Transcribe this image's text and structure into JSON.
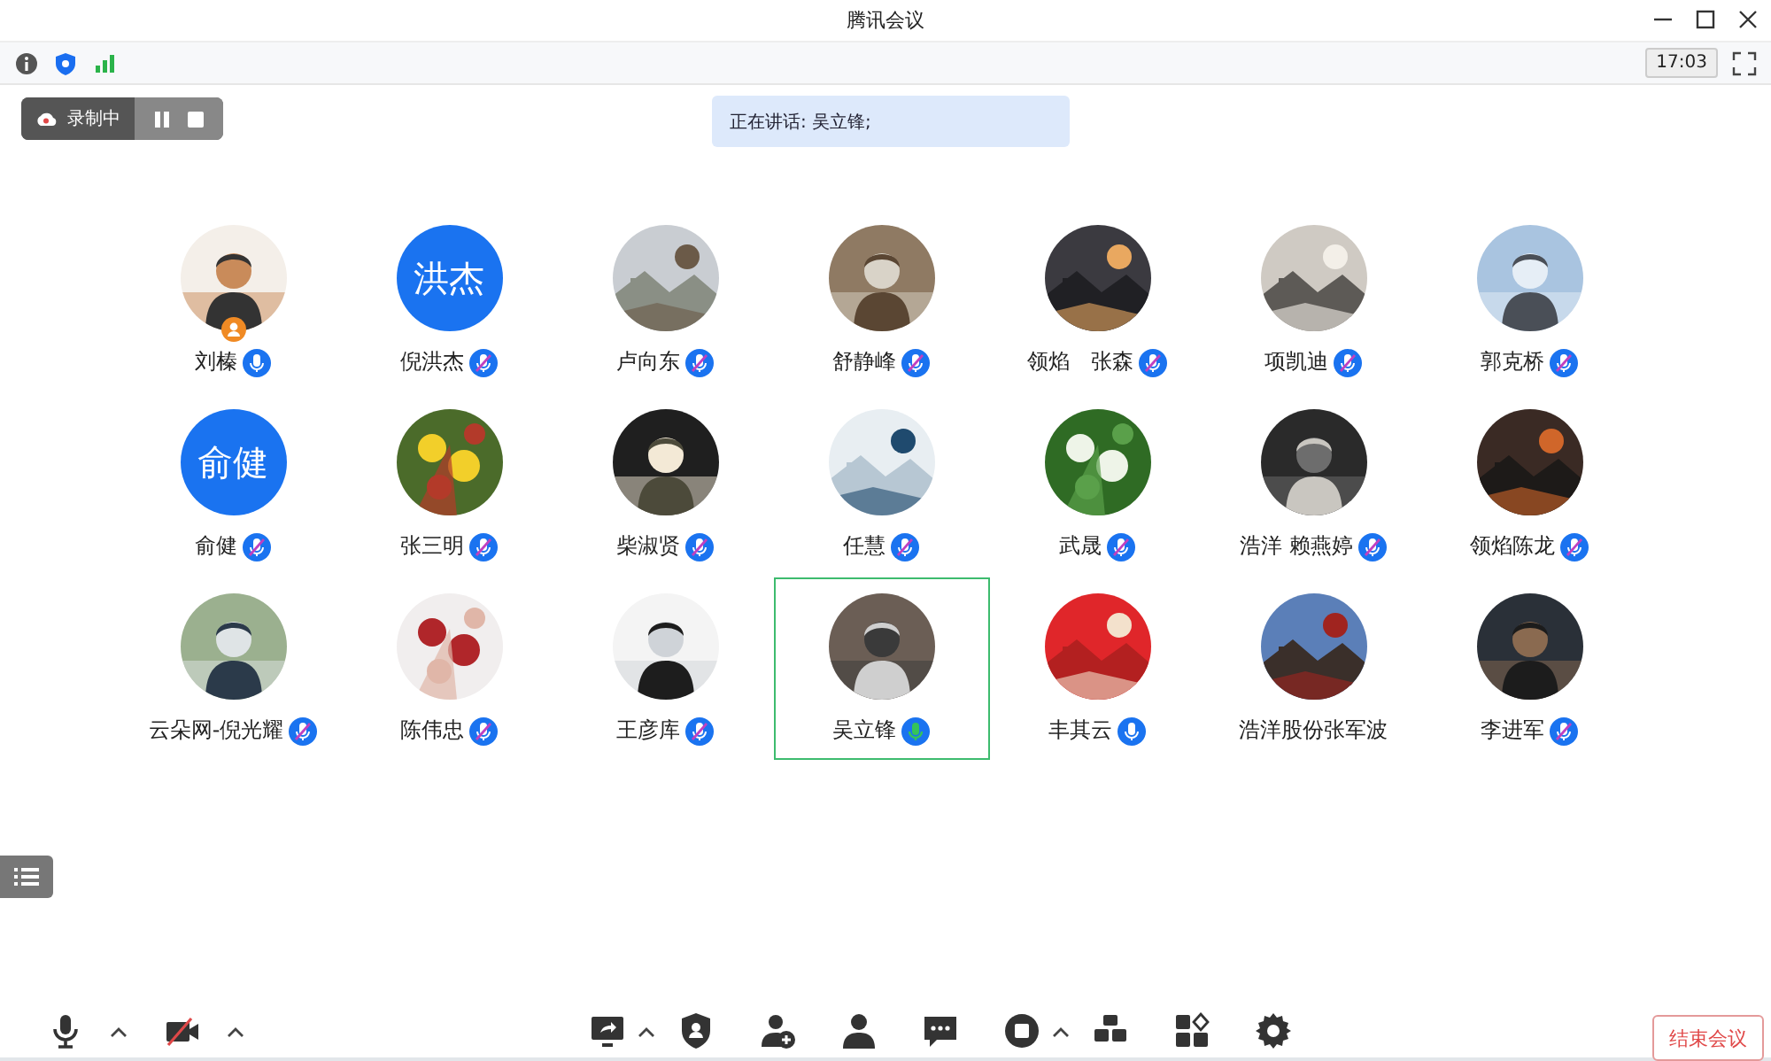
{
  "window": {
    "title": "腾讯会议"
  },
  "status_bar": {
    "time": "17:03"
  },
  "recording": {
    "label": "录制中",
    "paused": false
  },
  "speaking_banner": {
    "text": "正在讲话: 吴立锋;"
  },
  "participants": [
    {
      "name": "刘榛",
      "host": true,
      "mic": {
        "muted": false,
        "speaking": false
      },
      "selected": false
    },
    {
      "name": "倪洪杰",
      "avatar": {
        "kind": "text",
        "text": "洪杰"
      },
      "host": false,
      "mic": {
        "muted": true,
        "speaking": false
      },
      "selected": false
    },
    {
      "name": "卢向东",
      "host": false,
      "mic": {
        "muted": true,
        "speaking": false
      },
      "selected": false
    },
    {
      "name": "舒静峰",
      "host": false,
      "mic": {
        "muted": true,
        "speaking": false
      },
      "selected": false
    },
    {
      "name": "领焰　张森",
      "host": false,
      "mic": {
        "muted": true,
        "speaking": false
      },
      "selected": false
    },
    {
      "name": "项凯迪",
      "host": false,
      "mic": {
        "muted": true,
        "speaking": false
      },
      "selected": false
    },
    {
      "name": "郭克桥",
      "host": false,
      "mic": {
        "muted": true,
        "speaking": false
      },
      "selected": false
    },
    {
      "name": "俞健",
      "avatar": {
        "kind": "text",
        "text": "俞健"
      },
      "host": false,
      "mic": {
        "muted": true,
        "speaking": false
      },
      "selected": false
    },
    {
      "name": "张三明",
      "host": false,
      "mic": {
        "muted": true,
        "speaking": false
      },
      "selected": false
    },
    {
      "name": "柴淑贤",
      "host": false,
      "mic": {
        "muted": true,
        "speaking": false
      },
      "selected": false
    },
    {
      "name": "任慧",
      "host": false,
      "mic": {
        "muted": true,
        "speaking": false
      },
      "selected": false
    },
    {
      "name": "武晟",
      "host": false,
      "mic": {
        "muted": true,
        "speaking": false
      },
      "selected": false
    },
    {
      "name": "浩洋 赖燕婷",
      "host": false,
      "mic": {
        "muted": true,
        "speaking": false
      },
      "selected": false
    },
    {
      "name": "领焰陈龙",
      "host": false,
      "mic": {
        "muted": true,
        "speaking": false
      },
      "selected": false
    },
    {
      "name": "云朵网-倪光耀",
      "host": false,
      "mic": {
        "muted": true,
        "speaking": false
      },
      "selected": false
    },
    {
      "name": "陈伟忠",
      "host": false,
      "mic": {
        "muted": true,
        "speaking": false
      },
      "selected": false
    },
    {
      "name": "王彦库",
      "host": false,
      "mic": {
        "muted": true,
        "speaking": false
      },
      "selected": false
    },
    {
      "name": "吴立锋",
      "host": false,
      "mic": {
        "muted": false,
        "speaking": true
      },
      "selected": true
    },
    {
      "name": "丰其云",
      "host": false,
      "mic": {
        "muted": false,
        "speaking": false
      },
      "selected": false
    },
    {
      "name": "浩洋股份张军波",
      "host": false,
      "selected": false
    },
    {
      "name": "李进军",
      "host": false,
      "mic": {
        "muted": true,
        "speaking": false
      },
      "selected": false
    }
  ],
  "toolbar": {
    "left": [
      {
        "kind": "mic",
        "menu": true
      },
      {
        "kind": "camera-off",
        "menu": true
      }
    ],
    "center": [
      {
        "kind": "screen",
        "menu": true
      },
      {
        "kind": "shield",
        "menu": false
      },
      {
        "kind": "person-add",
        "menu": false
      },
      {
        "kind": "person",
        "menu": false
      },
      {
        "kind": "chat",
        "menu": false
      },
      {
        "kind": "record",
        "menu": true
      },
      {
        "kind": "blocks",
        "menu": false
      },
      {
        "kind": "apps",
        "menu": false
      },
      {
        "kind": "gear",
        "menu": false
      }
    ],
    "end_button": "结束会议"
  }
}
